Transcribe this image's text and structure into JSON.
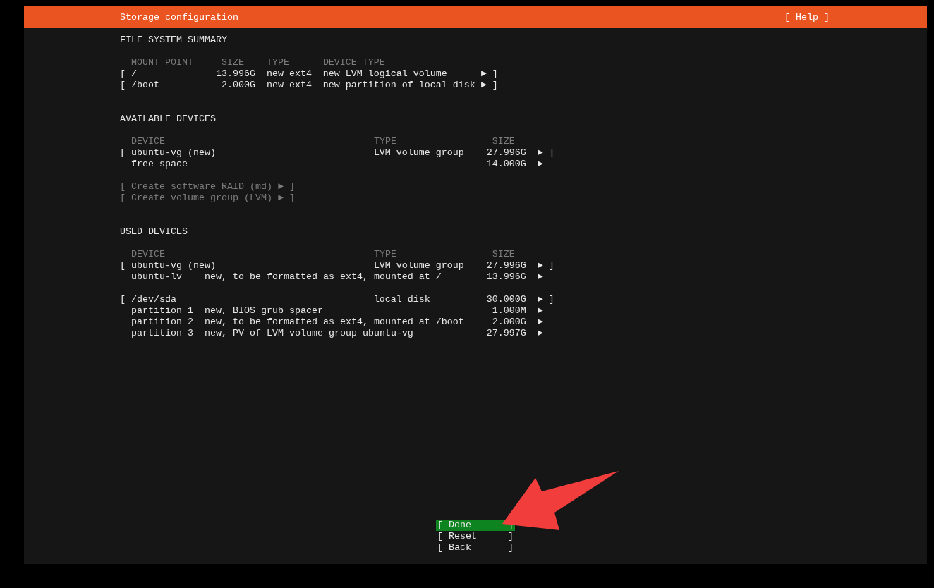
{
  "header": {
    "title": "Storage configuration",
    "help": "[ Help ]"
  },
  "file_system_summary": {
    "title": "FILE SYSTEM SUMMARY",
    "columns": [
      "MOUNT POINT",
      "SIZE",
      "TYPE",
      "DEVICE TYPE"
    ],
    "rows": [
      {
        "bracket": "[",
        "mount_point": "/",
        "size": "13.996G",
        "type": "new ext4",
        "device_type": "new LVM logical volume",
        "end": "► ]"
      },
      {
        "bracket": "[",
        "mount_point": "/boot",
        "size": "2.000G",
        "type": "new ext4",
        "device_type": "new partition of local disk",
        "end": "► ]"
      }
    ]
  },
  "available_devices": {
    "title": "AVAILABLE DEVICES",
    "columns": [
      "DEVICE",
      "TYPE",
      "SIZE"
    ],
    "groups": [
      {
        "rows": [
          {
            "kind": "device",
            "bracket": "[",
            "name": "ubuntu-vg (new)",
            "type": "LVM volume group",
            "size": "27.996G",
            "end": "► ]"
          },
          {
            "kind": "part",
            "name": "free space",
            "size": "14.000G",
            "end": "►"
          }
        ]
      }
    ],
    "actions": [
      {
        "label": "[ Create software RAID (md) ► ]",
        "disabled": true
      },
      {
        "label": "[ Create volume group (LVM) ► ]",
        "disabled": true
      }
    ]
  },
  "used_devices": {
    "title": "USED DEVICES",
    "columns": [
      "DEVICE",
      "TYPE",
      "SIZE"
    ],
    "groups": [
      {
        "rows": [
          {
            "kind": "device",
            "bracket": "[",
            "name": "ubuntu-vg (new)",
            "type": "LVM volume group",
            "size": "27.996G",
            "end": "► ]"
          },
          {
            "kind": "part",
            "name": "ubuntu-lv",
            "description": "new, to be formatted as ext4, mounted at /",
            "size": "13.996G",
            "end": "►"
          }
        ]
      },
      {
        "rows": [
          {
            "kind": "device",
            "bracket": "[",
            "name": "/dev/sda",
            "type": "local disk",
            "size": "30.000G",
            "end": "► ]"
          },
          {
            "kind": "part",
            "name": "partition 1",
            "description": "new, BIOS grub spacer",
            "size": "1.000M",
            "end": "►"
          },
          {
            "kind": "part",
            "name": "partition 2",
            "description": "new, to be formatted as ext4, mounted at /boot",
            "size": "2.000G",
            "end": "►"
          },
          {
            "kind": "part",
            "name": "partition 3",
            "description": "new, PV of LVM volume group ubuntu-vg",
            "size": "27.997G",
            "end": "►"
          }
        ]
      }
    ]
  },
  "buttons": [
    {
      "label": "[ Done",
      "close": "]",
      "selected": true
    },
    {
      "label": "[ Reset",
      "close": "]",
      "selected": false
    },
    {
      "label": "[ Back",
      "close": "]",
      "selected": false
    }
  ],
  "annotation": {
    "kind": "arrow"
  }
}
